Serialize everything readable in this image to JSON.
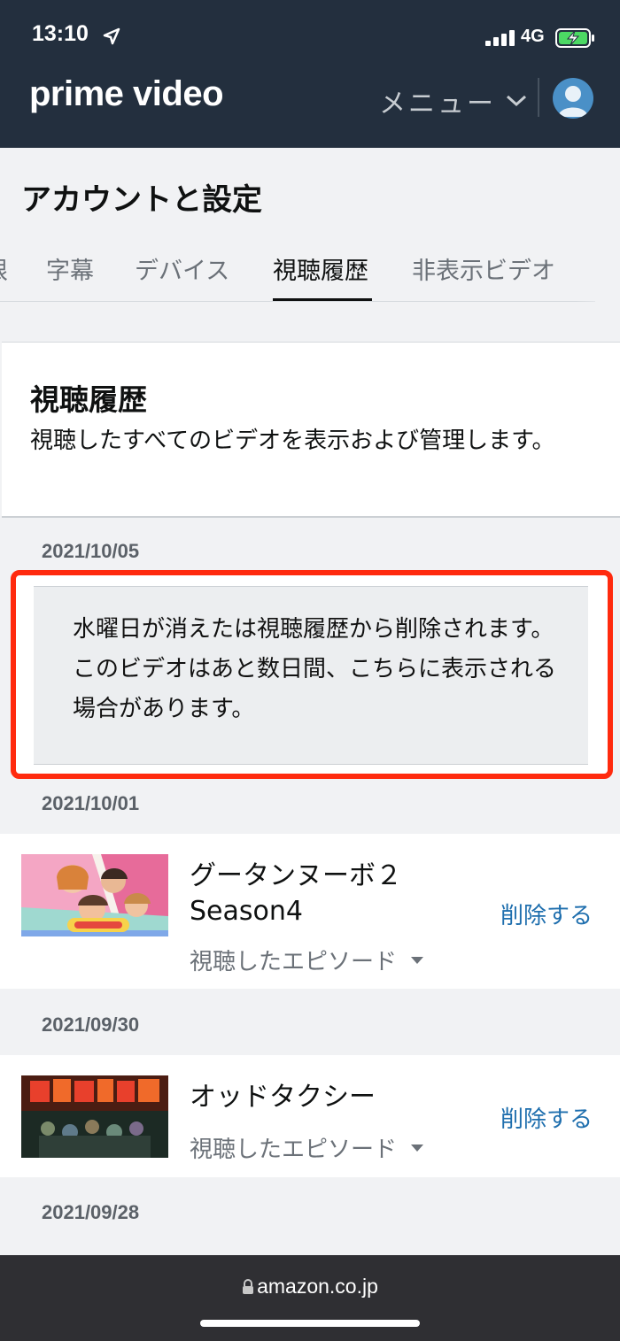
{
  "status_bar": {
    "time": "13:10",
    "network": "4G"
  },
  "header": {
    "logo": "prime video",
    "menu_label": "メニュー"
  },
  "account": {
    "title": "アカウントと設定"
  },
  "tabs": [
    {
      "label": "限"
    },
    {
      "label": "字幕"
    },
    {
      "label": "デバイス"
    },
    {
      "label": "視聴履歴"
    },
    {
      "label": "非表示ビデオ"
    }
  ],
  "intro": {
    "title": "視聴履歴",
    "description": "視聴したすべてのビデオを表示および管理します。"
  },
  "history": [
    {
      "date": "2021/10/05",
      "notice": "水曜日が消えたは視聴履歴から削除されます。このビデオはあと数日間、こちらに表示される場合があります。"
    },
    {
      "date": "2021/10/01",
      "title_line1": "グータンヌーボ２",
      "title_line2": "Season4",
      "subtitle": "視聴したエピソード",
      "delete_label": "削除する"
    },
    {
      "date": "2021/09/30",
      "title_line1": "オッドタクシー",
      "subtitle": "視聴したエピソード",
      "delete_label": "削除する"
    },
    {
      "date": "2021/09/28"
    }
  ],
  "browser": {
    "url": "amazon.co.jp"
  },
  "colors": {
    "header_bg": "#232f3e",
    "highlight_border": "#ff2a0e",
    "link": "#1f6fae"
  }
}
